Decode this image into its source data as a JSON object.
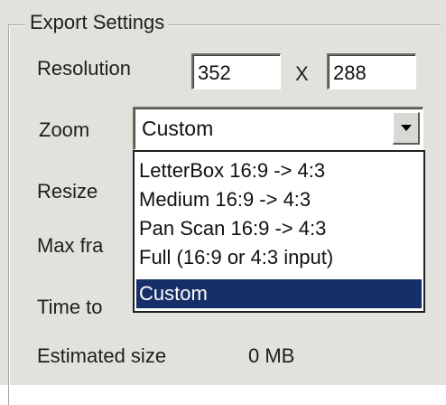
{
  "group": {
    "title": "Export Settings"
  },
  "fields": {
    "resolution_label": "Resolution",
    "width_value": "352",
    "x_label": "X",
    "height_value": "288",
    "zoom_label": "Zoom",
    "resize_label": "Resize",
    "max_frames_label": "Max fra",
    "time_label": "Time to",
    "estimated_size_label": "Estimated size",
    "estimated_size_value": "0 MB"
  },
  "zoom": {
    "selected": "Custom",
    "options": [
      {
        "label": "LetterBox 16:9 -> 4:3",
        "selected": false
      },
      {
        "label": "Medium    16:9 -> 4:3",
        "selected": false
      },
      {
        "label": "Pan Scan 16:9 -> 4:3",
        "selected": false
      },
      {
        "label": "Full (16:9 or 4:3 input)",
        "selected": false
      },
      {
        "label": "Custom",
        "selected": true
      }
    ]
  },
  "icons": {
    "combo_button": "chevron-down-icon"
  },
  "colors": {
    "panel": "#e2e2dc",
    "selection": "#172f68"
  }
}
